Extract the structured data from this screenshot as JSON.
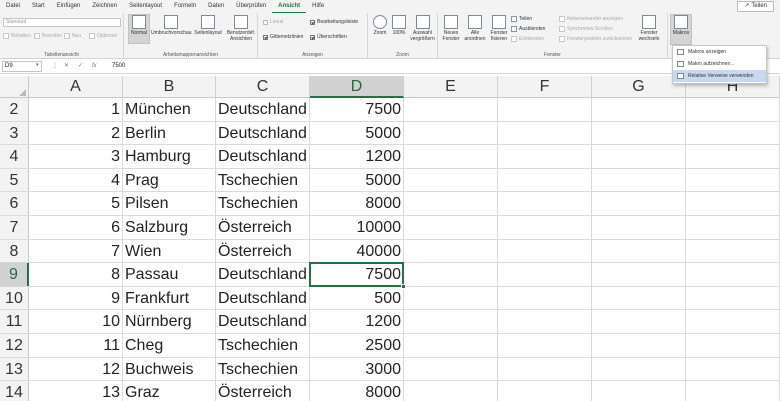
{
  "ribbon": {
    "tabs": [
      "Datei",
      "Start",
      "Einfügen",
      "Zeichnen",
      "Seitenlayout",
      "Formeln",
      "Daten",
      "Überprüfen",
      "Ansicht",
      "Hilfe"
    ],
    "active_tab": "Ansicht",
    "share_label": "Teilen",
    "groups": {
      "sheet_view": {
        "label": "Tabellenansicht",
        "select_value": "Standard",
        "keep": "Behalten",
        "exit": "Beenden",
        "new": "Neu",
        "options": "Optionen"
      },
      "workbook_views": {
        "label": "Arbeitsmappenansichten",
        "normal": "Normal",
        "page_break": "Umbruchvorschau",
        "page_layout": "Seitenlayout",
        "custom": "Benutzerdef. Ansichten"
      },
      "show": {
        "label": "Anzeigen",
        "ruler": "Lineal",
        "formula_bar": "Bearbeitungsleiste",
        "gridlines": "Gitternetzlinien",
        "headings": "Überschriften"
      },
      "zoom": {
        "label": "Zoom",
        "zoom": "Zoom",
        "hundred": "100%",
        "selection": "Auswahl vergrößern"
      },
      "window": {
        "label": "Fenster",
        "new_window": "Neues Fenster",
        "arrange_all": "Alle anordnen",
        "freeze_panes": "Fenster fixieren",
        "split": "Teilen",
        "hide": "Ausblenden",
        "unhide": "Einblenden",
        "side_by_side": "Nebeneinander anzeigen",
        "sync_scroll": "Synchrones Scrollen",
        "reset_position": "Fensterposition zurücksetzen",
        "switch": "Fenster wechseln"
      },
      "macros": {
        "label": "Makros",
        "menu": [
          "Makros anzeigen",
          "Makro aufzeichnen...",
          "Relative Verweise verwenden"
        ]
      }
    }
  },
  "formula_bar": {
    "name_box": "D9",
    "fx": "fx",
    "value": "7500"
  },
  "grid": {
    "columns": [
      "A",
      "B",
      "C",
      "D",
      "E",
      "F",
      "G",
      "H"
    ],
    "active_column": "D",
    "active_row": "9",
    "rows": [
      {
        "row": "2",
        "a": "1",
        "b": "München",
        "c": "Deutschland",
        "d": "7500"
      },
      {
        "row": "3",
        "a": "2",
        "b": "Berlin",
        "c": "Deutschland",
        "d": "5000"
      },
      {
        "row": "4",
        "a": "3",
        "b": "Hamburg",
        "c": "Deutschland",
        "d": "1200"
      },
      {
        "row": "5",
        "a": "4",
        "b": "Prag",
        "c": "Tschechien",
        "d": "5000"
      },
      {
        "row": "6",
        "a": "5",
        "b": "Pilsen",
        "c": "Tschechien",
        "d": "8000"
      },
      {
        "row": "7",
        "a": "6",
        "b": "Salzburg",
        "c": "Österreich",
        "d": "10000"
      },
      {
        "row": "8",
        "a": "7",
        "b": "Wien",
        "c": "Österreich",
        "d": "40000"
      },
      {
        "row": "9",
        "a": "8",
        "b": "Passau",
        "c": "Deutschland",
        "d": "7500"
      },
      {
        "row": "10",
        "a": "9",
        "b": "Frankfurt",
        "c": "Deutschland",
        "d": "500"
      },
      {
        "row": "11",
        "a": "10",
        "b": "Nürnberg",
        "c": "Deutschland",
        "d": "1200"
      },
      {
        "row": "12",
        "a": "11",
        "b": "Cheg",
        "c": "Tschechien",
        "d": "2500"
      },
      {
        "row": "13",
        "a": "12",
        "b": "Buchweis",
        "c": "Tschechien",
        "d": "3000"
      },
      {
        "row": "14",
        "a": "13",
        "b": "Graz",
        "c": "Österreich",
        "d": "8000"
      }
    ]
  },
  "colors": {
    "accent": "#217346",
    "menu_highlight": "#c6d9f0"
  }
}
